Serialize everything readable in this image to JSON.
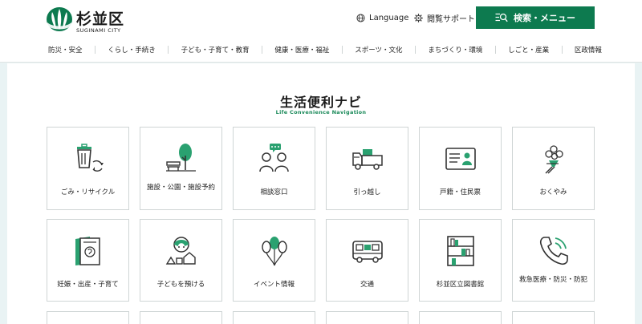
{
  "header": {
    "logo_ja": "杉並区",
    "logo_en": "SUGINAMI CITY",
    "language_label": "Language",
    "accessibility_label": "閲覧サポート",
    "search_menu_label": "検索・メニュー"
  },
  "nav": [
    "防災・安全",
    "くらし・手続き",
    "子ども・子育て・教育",
    "健康・医療・福祉",
    "スポーツ・文化",
    "まちづくり・環境",
    "しごと・産業",
    "区政情報"
  ],
  "section": {
    "title": "生活便利ナビ",
    "subtitle": "Life Convenience Navigation"
  },
  "cards": [
    {
      "label": "ごみ・リサイクル",
      "icon": "trash-recycle-icon"
    },
    {
      "label": "施設・公園・施設予約",
      "icon": "park-bench-tree-icon"
    },
    {
      "label": "相談窓口",
      "icon": "consultation-icon"
    },
    {
      "label": "引っ越し",
      "icon": "moving-truck-icon"
    },
    {
      "label": "戸籍・住民票",
      "icon": "id-card-icon"
    },
    {
      "label": "おくやみ",
      "icon": "flower-bouquet-icon"
    },
    {
      "label": "妊娠・出産・子育て",
      "icon": "maternity-handbook-icon"
    },
    {
      "label": "子どもを預ける",
      "icon": "childcare-house-icon"
    },
    {
      "label": "イベント情報",
      "icon": "balloons-icon"
    },
    {
      "label": "交通",
      "icon": "bus-icon"
    },
    {
      "label": "杉並区立図書館",
      "icon": "bookshelf-icon"
    },
    {
      "label": "救急医療・防災・防犯",
      "icon": "phone-emergency-icon"
    }
  ],
  "colors": {
    "accent": "#0d7a4f",
    "accent_light": "#2aa170",
    "page_background": "#e9f3f4"
  }
}
